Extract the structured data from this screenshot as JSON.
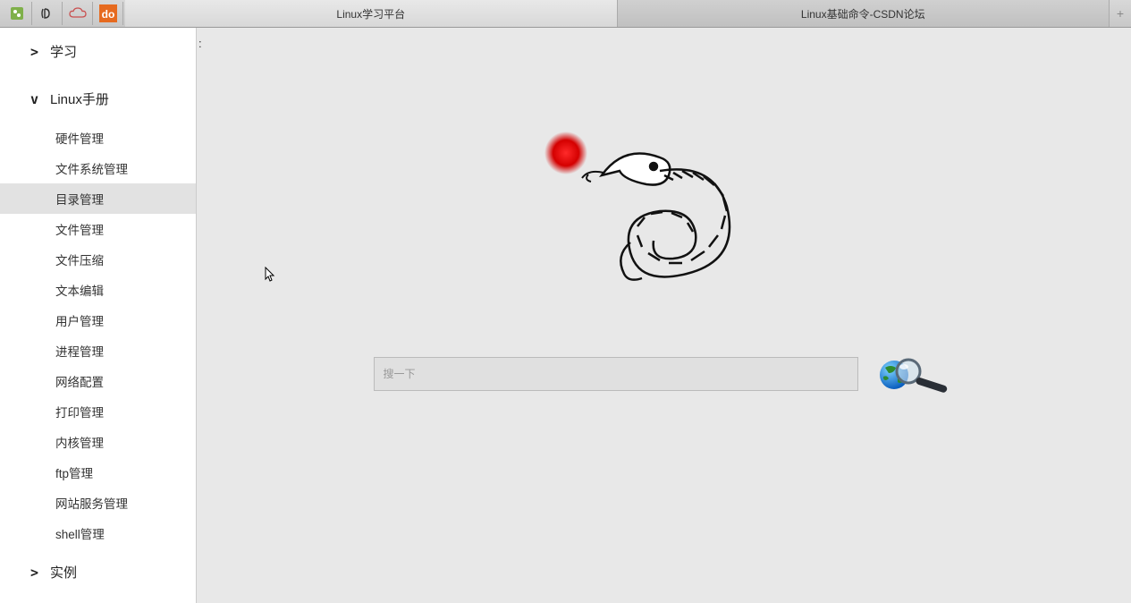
{
  "tabs": [
    {
      "label": "Linux学习平台",
      "active": true
    },
    {
      "label": "Linux基础命令-CSDN论坛",
      "active": false
    }
  ],
  "sidebar": {
    "sections": [
      {
        "label": "学习",
        "chevron": ">",
        "expanded": false
      },
      {
        "label": "Linux手册",
        "chevron": "v",
        "expanded": true,
        "items": [
          "硬件管理",
          "文件系统管理",
          "目录管理",
          "文件管理",
          "文件压缩",
          "文本编辑",
          "用户管理",
          "进程管理",
          "网络配置",
          "打印管理",
          "内核管理",
          "ftp管理",
          "网站服务管理",
          "shell管理"
        ],
        "active_index": 2
      },
      {
        "label": "实例",
        "chevron": ">",
        "expanded": false
      }
    ]
  },
  "content": {
    "header_marker": ":",
    "search_placeholder": "搜一下"
  }
}
